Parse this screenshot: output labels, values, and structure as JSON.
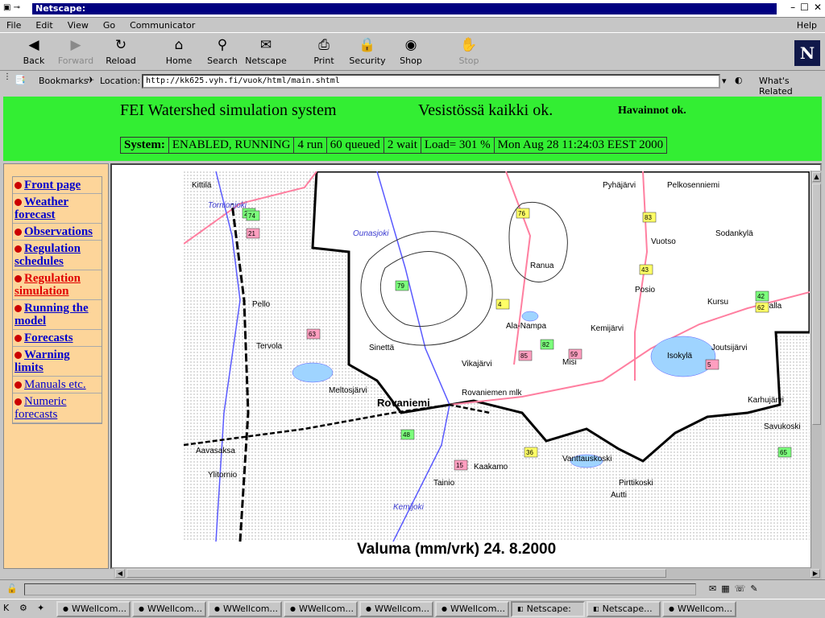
{
  "window": {
    "title": "Netscape:"
  },
  "menu": [
    "File",
    "Edit",
    "View",
    "Go",
    "Communicator"
  ],
  "menu_help": "Help",
  "toolbar": [
    {
      "label": "Back",
      "icon": "back-arrow-icon",
      "disabled": false,
      "glyph": "◀"
    },
    {
      "label": "Forward",
      "icon": "forward-arrow-icon",
      "disabled": true,
      "glyph": "▶"
    },
    {
      "label": "Reload",
      "icon": "reload-icon",
      "disabled": false,
      "glyph": "↻"
    },
    {
      "label": "Home",
      "icon": "home-icon",
      "disabled": false,
      "glyph": "⌂"
    },
    {
      "label": "Search",
      "icon": "search-icon",
      "disabled": false,
      "glyph": "⚲"
    },
    {
      "label": "Netscape",
      "icon": "netscape-icon",
      "disabled": false,
      "glyph": "✉"
    },
    {
      "label": "Print",
      "icon": "print-icon",
      "disabled": false,
      "glyph": "⎙"
    },
    {
      "label": "Security",
      "icon": "lock-icon",
      "disabled": false,
      "glyph": "🔒"
    },
    {
      "label": "Shop",
      "icon": "shop-icon",
      "disabled": false,
      "glyph": "◉"
    },
    {
      "label": "Stop",
      "icon": "stop-icon",
      "disabled": true,
      "glyph": "✋"
    }
  ],
  "brand_logo": "N",
  "location": {
    "bookmarks_label": "Bookmarks",
    "location_label": "Location:",
    "url": "http://kk625.vyh.fi/vuok/html/main.shtml",
    "whats_related": "What's Related"
  },
  "banner": {
    "title": "FEI Watershed simulation system",
    "status_fi": "Vesistössä kaikki ok.",
    "observations": "Havainnot ok.",
    "system_cells": [
      "System:",
      "ENABLED, RUNNING",
      "4 run",
      "60 queued",
      "2 wait",
      "Load= 301 %",
      "Mon Aug 28 11:24:03 EEST 2000"
    ]
  },
  "nav": [
    {
      "label": "Front page"
    },
    {
      "label": "Weather forecast"
    },
    {
      "label": "Observations"
    },
    {
      "label": "Regulation schedules"
    },
    {
      "label": "Regulation simulation",
      "active": true
    },
    {
      "label": "Running the model"
    },
    {
      "label": "Forecasts"
    },
    {
      "label": "Warning limits"
    },
    {
      "label": "Manuals etc.",
      "regular": true
    },
    {
      "label": "Numeric forecasts",
      "regular": true
    }
  ],
  "map": {
    "places": [
      "Pelkosenniemi",
      "Pyhäjärvi",
      "Sodankylä",
      "Kittilä",
      "Vuotso",
      "Pello",
      "Rovaniemi",
      "Rovaniemen mlk",
      "Kemijärvi",
      "Salla",
      "Ylitornio",
      "Tervola",
      "Ranua",
      "Posio",
      "Kursu",
      "Savukoski",
      "Tornionjoki",
      "Ounasjoki",
      "Kemijoki",
      "Misi",
      "Ala-Nampa",
      "Sinettä",
      "Meltosjärvi",
      "Vikajärvi",
      "Isokylä",
      "Joutsijärvi",
      "Karhujärvi",
      "Vanttauskoski",
      "Tainio",
      "Kaakamo",
      "Aavasaksa",
      "Pirttikoski",
      "Autti"
    ],
    "station_codes": [
      "23",
      "21",
      "76",
      "79",
      "63",
      "4",
      "82",
      "85",
      "83",
      "42",
      "5",
      "36",
      "48",
      "15",
      "43",
      "65",
      "59",
      "62",
      "74"
    ],
    "caption": "Valuma (mm/vrk) 24. 8.2000"
  },
  "taskbar": [
    "WWellcom...",
    "WWellcom...",
    "WWellcom...",
    "WWellcom...",
    "WWellcom...",
    "WWellcom...",
    "Netscape:",
    "Netscape...",
    "WWellcom..."
  ],
  "taskbar_active_index": 6,
  "colors": {
    "banner": "#33ee33",
    "sidebar": "#fdd59a",
    "link": "#0000cc",
    "link_active": "#e00000",
    "titlebar": "#000080"
  }
}
